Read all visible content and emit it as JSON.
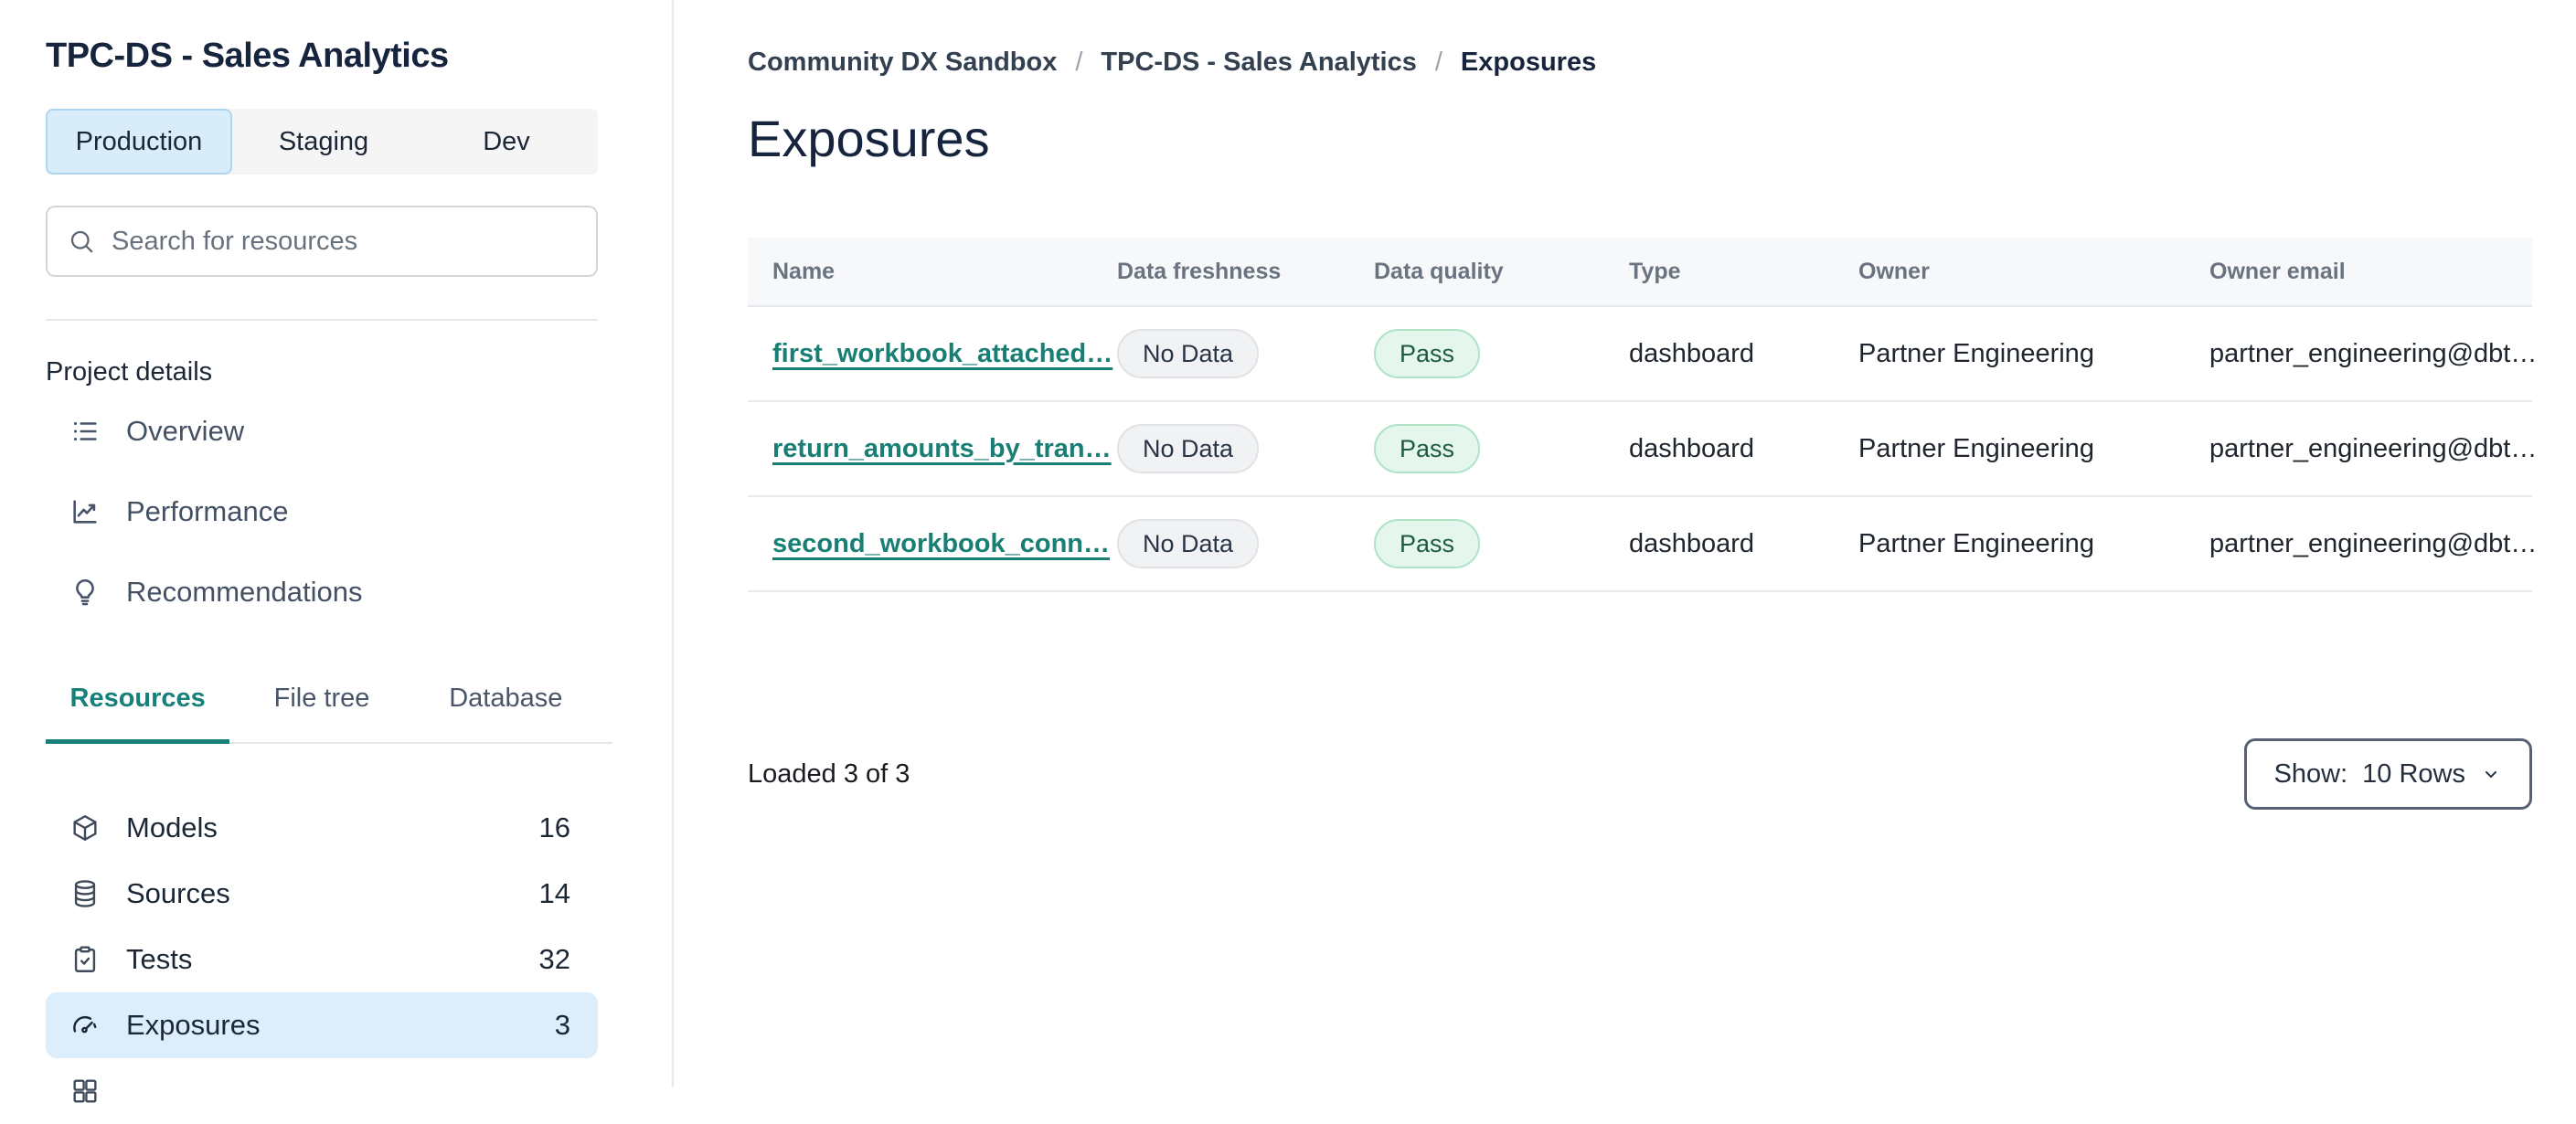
{
  "colors": {
    "accent_teal": "#17807A",
    "env_selected_bg": "#D8ECFA",
    "env_selected_border": "#AFD6F0",
    "sidebar_selected_bg": "#DCEEFB",
    "pass_badge_bg": "#E5F7EC",
    "pass_badge_border": "#AEE3C6",
    "pass_badge_text": "#1D5B40",
    "nodata_badge_bg": "#F1F2F3",
    "nodata_badge_border": "#E1E2E5",
    "dark_navy_text": "#16243D"
  },
  "sidebar": {
    "project_title": "TPC-DS - Sales Analytics",
    "env_tabs": [
      {
        "label": "Production",
        "active": true
      },
      {
        "label": "Staging",
        "active": false
      },
      {
        "label": "Dev",
        "active": false
      }
    ],
    "search": {
      "placeholder": "Search for resources"
    },
    "project_details": {
      "heading": "Project details",
      "items": [
        {
          "icon": "overview-list-icon",
          "label": "Overview"
        },
        {
          "icon": "performance-chart-icon",
          "label": "Performance"
        },
        {
          "icon": "lightbulb-icon",
          "label": "Recommendations"
        }
      ]
    },
    "resource_tabs": [
      {
        "label": "Resources",
        "active": true
      },
      {
        "label": "File tree",
        "active": false
      },
      {
        "label": "Database",
        "active": false
      }
    ],
    "resources": [
      {
        "icon": "cube-icon",
        "label": "Models",
        "count": "16",
        "selected": false
      },
      {
        "icon": "database-icon",
        "label": "Sources",
        "count": "14",
        "selected": false
      },
      {
        "icon": "clipboard-check-icon",
        "label": "Tests",
        "count": "32",
        "selected": false
      },
      {
        "icon": "gauge-icon",
        "label": "Exposures",
        "count": "3",
        "selected": true
      }
    ]
  },
  "main": {
    "breadcrumb": {
      "items": [
        "Community DX Sandbox",
        "TPC-DS - Sales Analytics",
        "Exposures"
      ],
      "separator": "/"
    },
    "page_title": "Exposures",
    "table": {
      "columns": [
        "Name",
        "Data freshness",
        "Data quality",
        "Type",
        "Owner",
        "Owner email"
      ],
      "rows": [
        {
          "name": "first_workbook_attached…",
          "data_freshness": "No Data",
          "data_quality": "Pass",
          "type": "dashboard",
          "owner": "Partner Engineering",
          "owner_email": "partner_engineering@dbt…"
        },
        {
          "name": "return_amounts_by_tran…",
          "data_freshness": "No Data",
          "data_quality": "Pass",
          "type": "dashboard",
          "owner": "Partner Engineering",
          "owner_email": "partner_engineering@dbt…"
        },
        {
          "name": "second_workbook_conn…",
          "data_freshness": "No Data",
          "data_quality": "Pass",
          "type": "dashboard",
          "owner": "Partner Engineering",
          "owner_email": "partner_engineering@dbt…"
        }
      ]
    },
    "footer": {
      "loaded_text": "Loaded 3 of 3",
      "show_label": "Show:",
      "show_value": "10 Rows"
    }
  }
}
